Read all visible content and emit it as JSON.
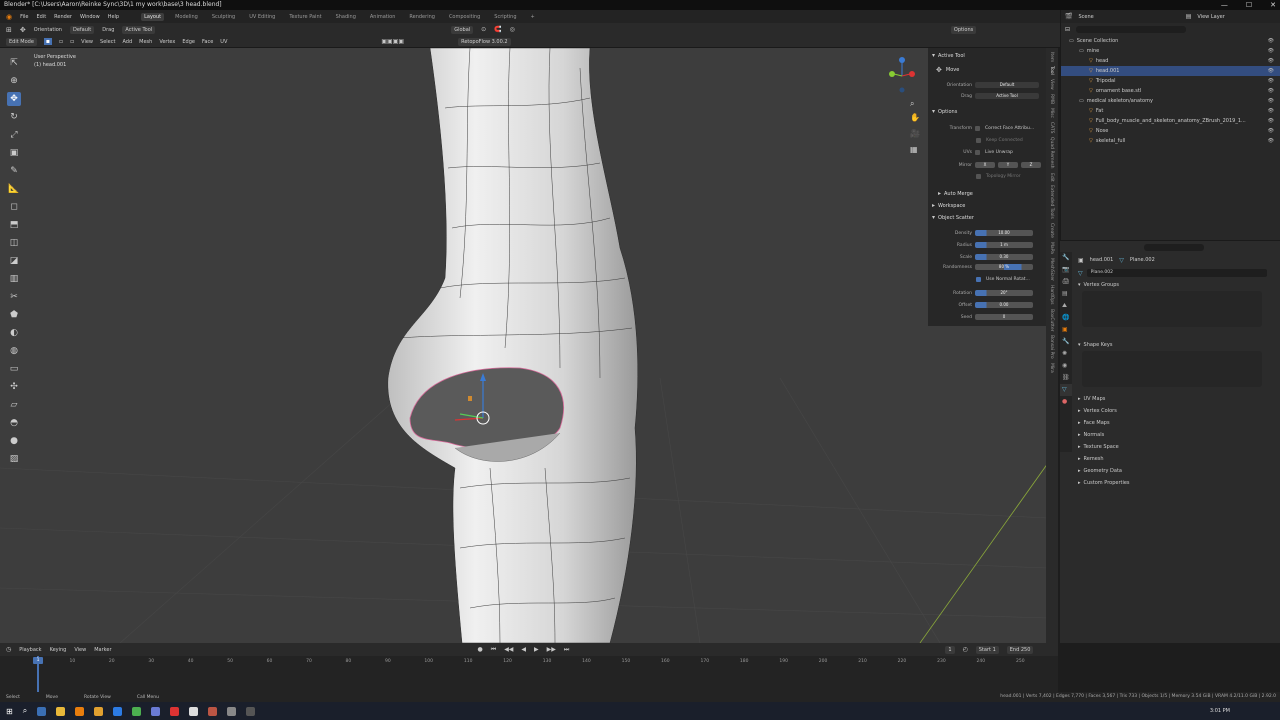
{
  "window": {
    "title": "Blender* [C:\\Users\\Aaron\\Reinke Sync\\3D\\1 my work\\base\\3 head.blend]"
  },
  "menu": [
    "File",
    "Edit",
    "Render",
    "Window",
    "Help"
  ],
  "workspaces": [
    "Layout",
    "Modeling",
    "Sculpting",
    "UV Editing",
    "Texture Paint",
    "Shading",
    "Animation",
    "Rendering",
    "Compositing",
    "Scripting",
    "+"
  ],
  "header": {
    "orientation_label": "Orientation",
    "orientation_value": "Default",
    "drag_label": "Drag",
    "drag_value": "Active Tool",
    "transform_value": "Global",
    "options_label": "Options",
    "scene_label": "Scene",
    "view_layer_label": "View Layer"
  },
  "header2": {
    "mode": "Edit Mode",
    "menus": [
      "View",
      "Select",
      "Add",
      "Mesh",
      "Vertex",
      "Edge",
      "Face",
      "UV"
    ],
    "retopoflow": "RetopoFlow 3.00.2"
  },
  "viewport": {
    "line1": "User Perspective",
    "line2": "(1) head.001"
  },
  "npanel": {
    "active_tool_title": "Active Tool",
    "tool_name": "Move",
    "orientation_label": "Orientation",
    "orientation_value": "Default",
    "drag_label": "Drag",
    "drag_value": "Active Tool",
    "options_title": "Options",
    "transform_label": "Transform",
    "correct_face": "Correct Face Attribu...",
    "keep_connected": "Keep Connected",
    "uvs_label": "UVs",
    "live_unwrap": "Live Unwrap",
    "mirror_label": "Mirror",
    "mirror_axes": [
      "X",
      "Y",
      "Z"
    ],
    "topology_mirror": "Topology Mirror",
    "auto_merge": "Auto Merge",
    "workspace": "Workspace",
    "object_scatter": "Object Scatter",
    "scatter": [
      {
        "label": "Density",
        "value": "10.00"
      },
      {
        "label": "Radius",
        "value": "1 m"
      },
      {
        "label": "Scale",
        "value": "0.30"
      },
      {
        "label": "Randomness",
        "value": "80 %"
      }
    ],
    "use_normal_rotation": "Use Normal Rotat...",
    "scatter2": [
      {
        "label": "Rotation",
        "value": "20°"
      },
      {
        "label": "Offset",
        "value": "0.00"
      },
      {
        "label": "Seed",
        "value": "0"
      }
    ]
  },
  "ntabs": [
    "Item",
    "Tool",
    "View",
    "RMB",
    "Misc",
    "CATS",
    "Quad Remesh",
    "Edit",
    "Extended Tools",
    "Create",
    "MaPa",
    "MeshSizer",
    "HardOps",
    "BoxCutter",
    "Bonsai Pro",
    "Mira"
  ],
  "outliner": {
    "title": "Scene Collection",
    "rows": [
      {
        "name": "Scene Collection",
        "indent": 0,
        "sel": false
      },
      {
        "name": "mine",
        "indent": 1,
        "sel": false
      },
      {
        "name": "head",
        "indent": 2,
        "sel": false
      },
      {
        "name": "head.001",
        "indent": 2,
        "sel": true
      },
      {
        "name": "Tripodal",
        "indent": 2,
        "sel": false
      },
      {
        "name": "ornament base.stl",
        "indent": 2,
        "sel": false
      },
      {
        "name": "medical skeleton/anatomy",
        "indent": 1,
        "sel": false
      },
      {
        "name": "Fat",
        "indent": 2,
        "sel": false
      },
      {
        "name": "Full_body_muscle_and_skeleton_anatomy_ZBrush_2019_1...",
        "indent": 2,
        "sel": false
      },
      {
        "name": "Nose",
        "indent": 2,
        "sel": false
      },
      {
        "name": "skeletal_full",
        "indent": 2,
        "sel": false
      }
    ]
  },
  "properties": {
    "object_name": "head.001",
    "mesh_name": "Plane.002",
    "data_name": "Plane.002",
    "sections": [
      "Vertex Groups",
      "Shape Keys"
    ],
    "collapsed": [
      "UV Maps",
      "Vertex Colors",
      "Face Maps",
      "Normals",
      "Texture Space",
      "Remesh",
      "Geometry Data",
      "Custom Properties"
    ]
  },
  "timeline": {
    "menus": [
      "Playback",
      "Keying",
      "View",
      "Marker"
    ],
    "current_frame": "1",
    "start_label": "Start",
    "start_value": "1",
    "end_label": "End",
    "end_value": "250",
    "ticks": [
      "1",
      "10",
      "20",
      "30",
      "40",
      "50",
      "60",
      "70",
      "80",
      "90",
      "100",
      "110",
      "120",
      "130",
      "140",
      "150",
      "160",
      "170",
      "180",
      "190",
      "200",
      "210",
      "220",
      "230",
      "240",
      "250"
    ]
  },
  "status": {
    "items": [
      "Select",
      "Move",
      "Rotate View",
      "Call Menu"
    ],
    "right": "head.001 | Verts 7,402 | Edges 7,770 | Faces 3,567 | Tris 733 | Objects 1/5 | Memory 3.54 GiB | VRAM 4.2/11.0 GiB | 2.92.0"
  },
  "taskbar": {
    "time": "3:01 PM"
  },
  "colors": {
    "accent": "#4772b3",
    "selected_row": "#334d80",
    "viewport_bg": "#3d3d3d"
  }
}
